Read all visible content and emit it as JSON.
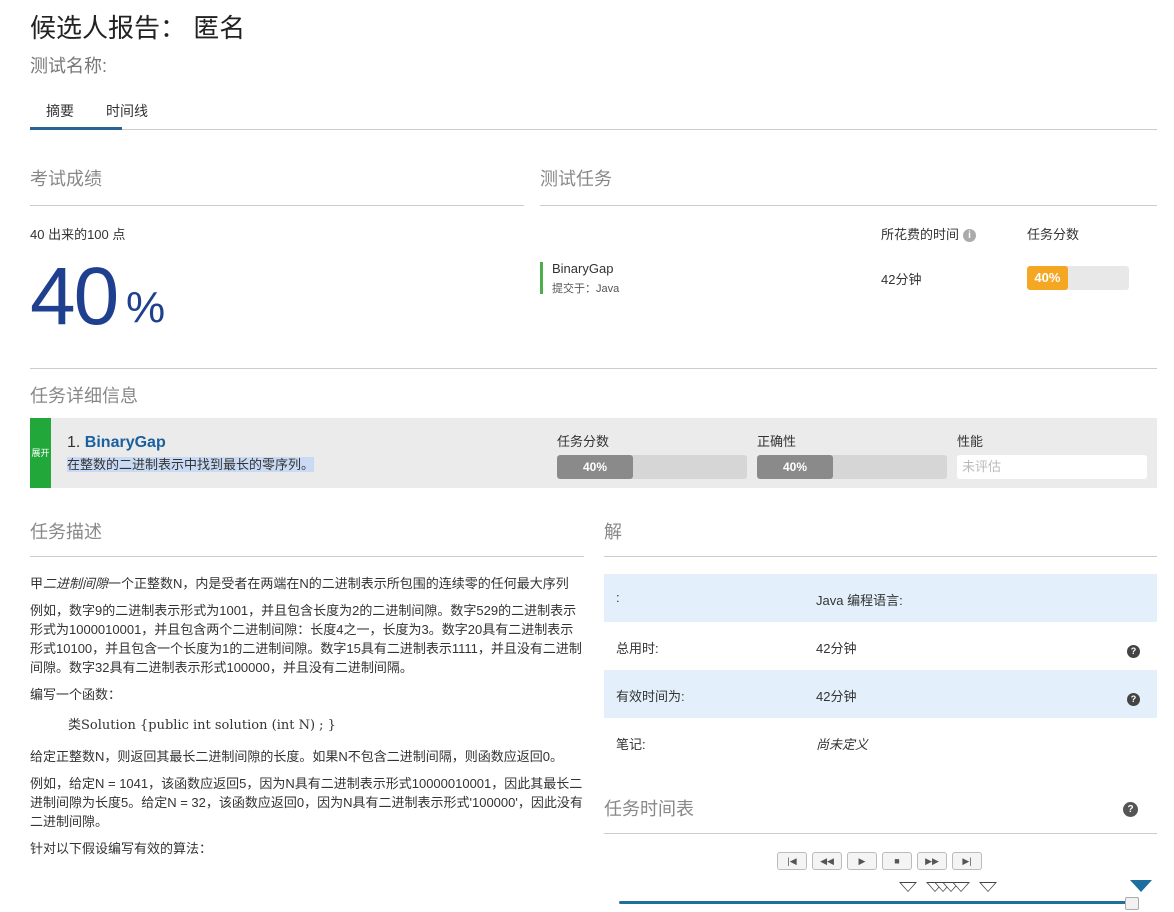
{
  "header": {
    "title": "候选人报告：  匿名",
    "subtitle": "测试名称:"
  },
  "tabs": [
    {
      "label": "摘要"
    },
    {
      "label": "时间线"
    }
  ],
  "score_section": {
    "heading": "考试成绩",
    "points_text": "40 出来的100 点",
    "percent_number": "40",
    "percent_sign": "%",
    "score_value": 40
  },
  "test_tasks": {
    "heading": "测试任务",
    "col_time": "所花费的时间",
    "col_score": "任务分数",
    "task_name": "BinaryGap",
    "submitted": "提交于：Java",
    "time_spent": "42分钟",
    "score_label": "40%",
    "score_value": 40
  },
  "task_details": {
    "heading": "任务详细信息",
    "expand_label": "展开",
    "number": "1.",
    "name": "BinaryGap",
    "summary": "在整数的二进制表示中找到最长的零序列。",
    "task_score_label": "任务分数",
    "task_score_text": "40%",
    "task_score_value": 40,
    "correctness_label": "正确性",
    "correctness_text": "40%",
    "correctness_value": 40,
    "performance_label": "性能",
    "performance_text": "未评估"
  },
  "description": {
    "heading": "任务描述",
    "p1_a": "甲",
    "p1_em": "二进制间隙",
    "p1_b": "一个正整数N，内是受者在两端在N的二进制表示所包围的连续零的任何最大序列",
    "p2": "例如，数字9的二进制表示形式为1001，并且包含长度为2的二进制间隙。数字529的二进制表示形式为1000010001，并且包含两个二进制间隙：长度4之一，长度为3。数字20具有二进制表示形式10100，并且包含一个长度为1的二进制间隙。数字15具有二进制表示1111，并且没有二进制间隙。数字32具有二进制表示形式100000，并且没有二进制间隔。",
    "p3": "编写一个函数：",
    "code": "类Solution {public int solution (int N) ; }",
    "p4": "给定正整数N，则返回其最长二进制间隙的长度。如果N不包含二进制间隔，则函数应返回0。",
    "p5": "例如，给定N = 1041，该函数应返回5，因为N具有二进制表示形式10000010001，因此其最长二进制间隙为长度5。给定N = 32，该函数应返回0，因为N具有二进制表示形式'100000'，因此没有二进制间隙。",
    "p6": "针对以下假设编写有效的算法："
  },
  "solution": {
    "heading": "解",
    "rows": [
      {
        "key": ":",
        "value": "Java 编程语言:"
      },
      {
        "key": "总用时:",
        "value": "42分钟"
      },
      {
        "key": "有效时间为:",
        "value": "42分钟"
      },
      {
        "key": "笔记:",
        "value": "尚未定义"
      }
    ],
    "help_icon_text": "?"
  },
  "timeline": {
    "heading": "任务时间表",
    "controls": [
      "|◀",
      "◀◀",
      "▶",
      "■",
      "▶▶",
      "▶|"
    ],
    "slider_position": 1.0
  },
  "colors": {
    "accent": "#1f3f8f",
    "link": "#1a5f9e",
    "green": "#22a83a",
    "orange": "#f5a623",
    "bar_grey": "#8a8a8a",
    "row_blue": "#e3f0fb"
  }
}
